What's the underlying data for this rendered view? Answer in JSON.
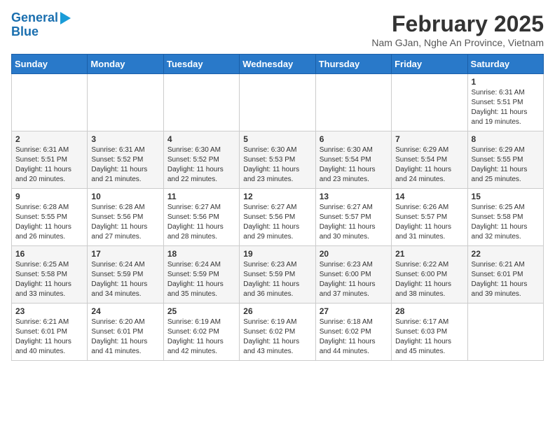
{
  "logo": {
    "line1": "General",
    "line2": "Blue"
  },
  "title": "February 2025",
  "subtitle": "Nam GJan, Nghe An Province, Vietnam",
  "days_of_week": [
    "Sunday",
    "Monday",
    "Tuesday",
    "Wednesday",
    "Thursday",
    "Friday",
    "Saturday"
  ],
  "weeks": [
    [
      {
        "day": "",
        "info": ""
      },
      {
        "day": "",
        "info": ""
      },
      {
        "day": "",
        "info": ""
      },
      {
        "day": "",
        "info": ""
      },
      {
        "day": "",
        "info": ""
      },
      {
        "day": "",
        "info": ""
      },
      {
        "day": "1",
        "info": "Sunrise: 6:31 AM\nSunset: 5:51 PM\nDaylight: 11 hours\nand 19 minutes."
      }
    ],
    [
      {
        "day": "2",
        "info": "Sunrise: 6:31 AM\nSunset: 5:51 PM\nDaylight: 11 hours\nand 20 minutes."
      },
      {
        "day": "3",
        "info": "Sunrise: 6:31 AM\nSunset: 5:52 PM\nDaylight: 11 hours\nand 21 minutes."
      },
      {
        "day": "4",
        "info": "Sunrise: 6:30 AM\nSunset: 5:52 PM\nDaylight: 11 hours\nand 22 minutes."
      },
      {
        "day": "5",
        "info": "Sunrise: 6:30 AM\nSunset: 5:53 PM\nDaylight: 11 hours\nand 23 minutes."
      },
      {
        "day": "6",
        "info": "Sunrise: 6:30 AM\nSunset: 5:54 PM\nDaylight: 11 hours\nand 23 minutes."
      },
      {
        "day": "7",
        "info": "Sunrise: 6:29 AM\nSunset: 5:54 PM\nDaylight: 11 hours\nand 24 minutes."
      },
      {
        "day": "8",
        "info": "Sunrise: 6:29 AM\nSunset: 5:55 PM\nDaylight: 11 hours\nand 25 minutes."
      }
    ],
    [
      {
        "day": "9",
        "info": "Sunrise: 6:28 AM\nSunset: 5:55 PM\nDaylight: 11 hours\nand 26 minutes."
      },
      {
        "day": "10",
        "info": "Sunrise: 6:28 AM\nSunset: 5:56 PM\nDaylight: 11 hours\nand 27 minutes."
      },
      {
        "day": "11",
        "info": "Sunrise: 6:27 AM\nSunset: 5:56 PM\nDaylight: 11 hours\nand 28 minutes."
      },
      {
        "day": "12",
        "info": "Sunrise: 6:27 AM\nSunset: 5:56 PM\nDaylight: 11 hours\nand 29 minutes."
      },
      {
        "day": "13",
        "info": "Sunrise: 6:27 AM\nSunset: 5:57 PM\nDaylight: 11 hours\nand 30 minutes."
      },
      {
        "day": "14",
        "info": "Sunrise: 6:26 AM\nSunset: 5:57 PM\nDaylight: 11 hours\nand 31 minutes."
      },
      {
        "day": "15",
        "info": "Sunrise: 6:25 AM\nSunset: 5:58 PM\nDaylight: 11 hours\nand 32 minutes."
      }
    ],
    [
      {
        "day": "16",
        "info": "Sunrise: 6:25 AM\nSunset: 5:58 PM\nDaylight: 11 hours\nand 33 minutes."
      },
      {
        "day": "17",
        "info": "Sunrise: 6:24 AM\nSunset: 5:59 PM\nDaylight: 11 hours\nand 34 minutes."
      },
      {
        "day": "18",
        "info": "Sunrise: 6:24 AM\nSunset: 5:59 PM\nDaylight: 11 hours\nand 35 minutes."
      },
      {
        "day": "19",
        "info": "Sunrise: 6:23 AM\nSunset: 5:59 PM\nDaylight: 11 hours\nand 36 minutes."
      },
      {
        "day": "20",
        "info": "Sunrise: 6:23 AM\nSunset: 6:00 PM\nDaylight: 11 hours\nand 37 minutes."
      },
      {
        "day": "21",
        "info": "Sunrise: 6:22 AM\nSunset: 6:00 PM\nDaylight: 11 hours\nand 38 minutes."
      },
      {
        "day": "22",
        "info": "Sunrise: 6:21 AM\nSunset: 6:01 PM\nDaylight: 11 hours\nand 39 minutes."
      }
    ],
    [
      {
        "day": "23",
        "info": "Sunrise: 6:21 AM\nSunset: 6:01 PM\nDaylight: 11 hours\nand 40 minutes."
      },
      {
        "day": "24",
        "info": "Sunrise: 6:20 AM\nSunset: 6:01 PM\nDaylight: 11 hours\nand 41 minutes."
      },
      {
        "day": "25",
        "info": "Sunrise: 6:19 AM\nSunset: 6:02 PM\nDaylight: 11 hours\nand 42 minutes."
      },
      {
        "day": "26",
        "info": "Sunrise: 6:19 AM\nSunset: 6:02 PM\nDaylight: 11 hours\nand 43 minutes."
      },
      {
        "day": "27",
        "info": "Sunrise: 6:18 AM\nSunset: 6:02 PM\nDaylight: 11 hours\nand 44 minutes."
      },
      {
        "day": "28",
        "info": "Sunrise: 6:17 AM\nSunset: 6:03 PM\nDaylight: 11 hours\nand 45 minutes."
      },
      {
        "day": "",
        "info": ""
      }
    ]
  ]
}
